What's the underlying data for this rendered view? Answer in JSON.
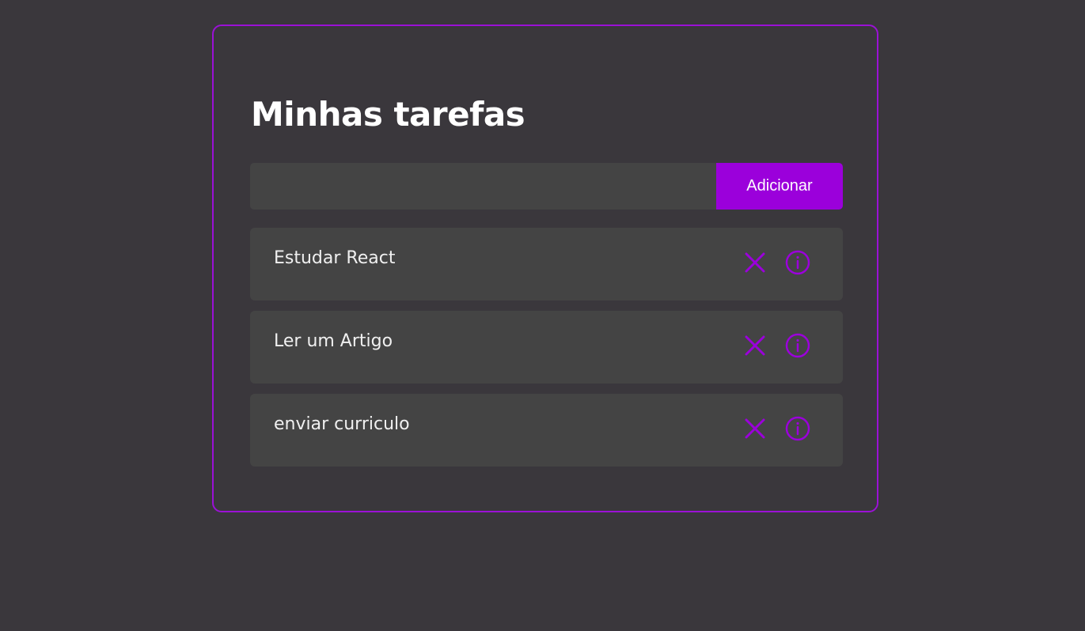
{
  "app": {
    "title": "Minhas tarefas"
  },
  "add_form": {
    "input_value": "",
    "input_placeholder": "",
    "button_label": "Adicionar"
  },
  "tasks": [
    {
      "title": "Estudar React",
      "remove_icon": "close-icon",
      "info_icon": "info-icon"
    },
    {
      "title": "Ler um Artigo",
      "remove_icon": "close-icon",
      "info_icon": "info-icon"
    },
    {
      "title": "enviar curriculo",
      "remove_icon": "close-icon",
      "info_icon": "info-icon"
    }
  ],
  "colors": {
    "background": "#3a373c",
    "accent": "#9b00db",
    "card_border": "#9b11d6",
    "item_background": "#444444",
    "text": "#ffffff"
  }
}
